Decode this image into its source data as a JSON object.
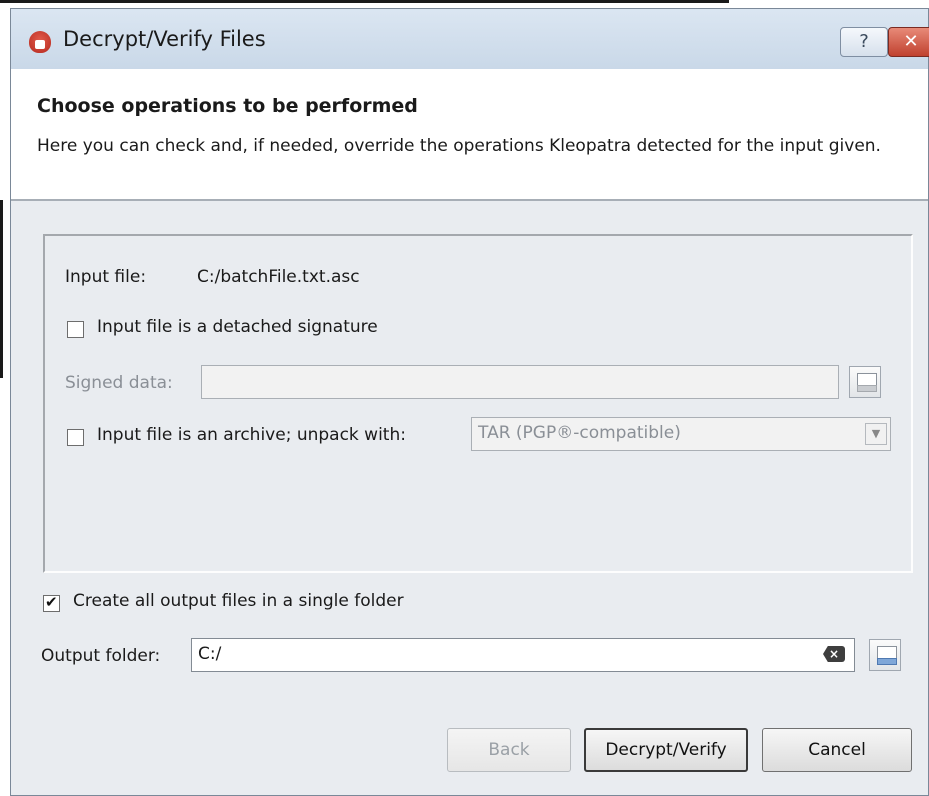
{
  "window": {
    "title": "Decrypt/Verify Files",
    "help_label": "?",
    "close_label": "✕"
  },
  "header": {
    "title": "Choose operations to be performed",
    "description": "Here you can check and, if needed, override the operations Kleopatra detected for the input given."
  },
  "input": {
    "file_label": "Input file:",
    "file_value": "C:/batchFile.txt.asc",
    "detached_label": "Input file is a detached signature",
    "detached_checked": false,
    "signed_data_label": "Signed data:",
    "signed_data_value": "",
    "archive_label": "Input file is an archive; unpack with:",
    "archive_checked": false,
    "archive_option": "TAR (PGP®-compatible)"
  },
  "output": {
    "single_folder_label": "Create all output files in a single folder",
    "single_folder_checked": true,
    "folder_label": "Output folder:",
    "folder_value": "C:/"
  },
  "buttons": {
    "back": "Back",
    "decrypt_verify": "Decrypt/Verify",
    "cancel": "Cancel"
  }
}
